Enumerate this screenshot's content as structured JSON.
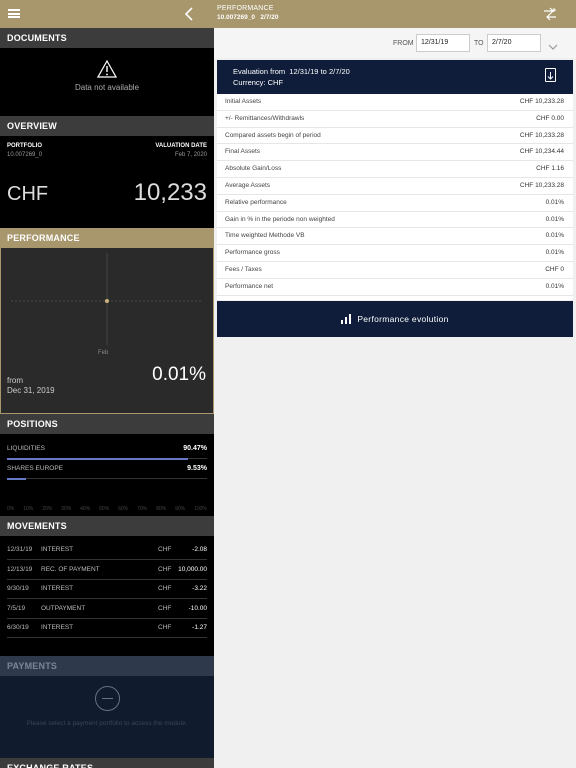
{
  "header": {
    "title": "PERFORMANCE",
    "portfolio": "10.007269_0",
    "date": "2/7/20"
  },
  "documents": {
    "heading": "DOCUMENTS",
    "empty_text": "Data not available"
  },
  "overview": {
    "heading": "OVERVIEW",
    "portfolio_label": "PORTFOLIO",
    "portfolio_value": "10.007269_0",
    "valuation_label": "VALUATION DATE",
    "valuation_value": "Feb 7, 2020",
    "currency": "CHF",
    "amount": "10,233"
  },
  "performance": {
    "heading": "PERFORMANCE",
    "axis_label": "Feb",
    "from_label": "from",
    "from_date": "Dec 31, 2019",
    "value": "0.01%"
  },
  "positions": {
    "heading": "POSITIONS",
    "items": [
      {
        "label": "LIQUIDITIES",
        "value": "90.47%",
        "fraction": 0.9047
      },
      {
        "label": "SHARES EUROPE",
        "value": "9.53%",
        "fraction": 0.0953
      }
    ],
    "scale": [
      "0%",
      "10%",
      "20%",
      "30%",
      "40%",
      "50%",
      "60%",
      "70%",
      "80%",
      "90%",
      "100%"
    ]
  },
  "movements": {
    "heading": "MOVEMENTS",
    "rows": [
      {
        "date": "12/31/19",
        "type": "INTEREST",
        "currency": "CHF",
        "amount": "-2.08"
      },
      {
        "date": "12/13/19",
        "type": "REC. OF PAYMENT",
        "currency": "CHF",
        "amount": "10,000.00"
      },
      {
        "date": "9/30/19",
        "type": "INTEREST",
        "currency": "CHF",
        "amount": "-3.22"
      },
      {
        "date": "7/5/19",
        "type": "OUTPAYMENT",
        "currency": "CHF",
        "amount": "-10.00"
      },
      {
        "date": "6/30/19",
        "type": "INTEREST",
        "currency": "CHF",
        "amount": "-1.27"
      }
    ]
  },
  "payments": {
    "heading": "PAYMENTS",
    "text": "Please select a payment portfolio to access the module."
  },
  "exchange": {
    "heading": "EXCHANGE RATES"
  },
  "filter": {
    "from_label": "FROM",
    "from_value": "12/31/19",
    "to_label": "TO",
    "to_value": "2/7/20"
  },
  "evaluation": {
    "title_prefix": "Evaluation from",
    "from": "12/31/19",
    "to_word": "to",
    "to": "2/7/20",
    "currency_label": "Currency:",
    "currency": "CHF",
    "rows": [
      {
        "label": "Initial Assets",
        "value": "CHF 10,233.28"
      },
      {
        "label": "+/- Remittances/Withdrawls",
        "value": "CHF 0.00"
      },
      {
        "label": "Compared assets begin of period",
        "value": "CHF 10,233.28"
      },
      {
        "label": "Final Assets",
        "value": "CHF 10,234.44"
      },
      {
        "label": "Absolute Gain/Loss",
        "value": "CHF 1.16"
      },
      {
        "label": "Average Assets",
        "value": "CHF 10,233.28"
      },
      {
        "label": "Relative performance",
        "value": "0.01%"
      },
      {
        "label": "Gain in % in the periode non weighted",
        "value": "0.01%"
      },
      {
        "label": "Time weighted Methode VB",
        "value": "0.01%"
      },
      {
        "label": "Performance gross",
        "value": "0.01%"
      },
      {
        "label": "Fees / Taxes",
        "value": "CHF 0"
      },
      {
        "label": "Performance net",
        "value": "0.01%"
      }
    ],
    "button_label": "Performance evolution"
  },
  "colors": {
    "gold": "#a8976c",
    "navy": "#0f1d3a",
    "bar": "#6678c6"
  }
}
